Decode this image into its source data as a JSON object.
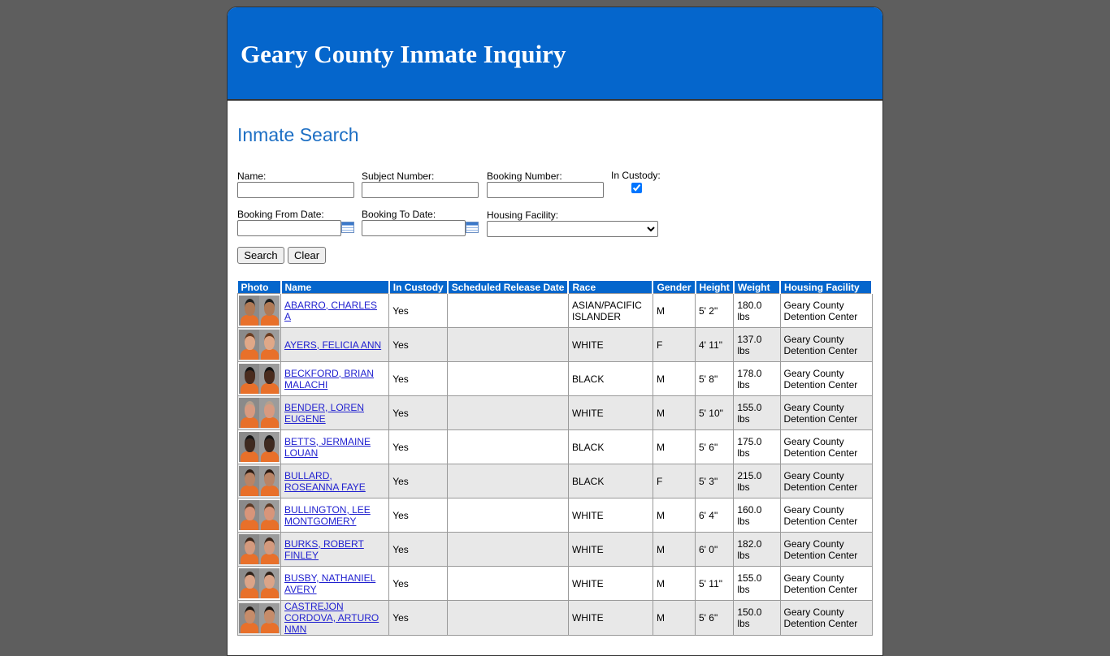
{
  "header": {
    "title": "Geary County Inmate Inquiry"
  },
  "search": {
    "heading": "Inmate Search",
    "name_label": "Name:",
    "name_value": "",
    "subject_label": "Subject Number:",
    "subject_value": "",
    "booking_label": "Booking Number:",
    "booking_value": "",
    "custody_label": "In Custody:",
    "custody_checked": true,
    "from_label": "Booking From Date:",
    "from_value": "",
    "to_label": "Booking To Date:",
    "to_value": "",
    "facility_label": "Housing Facility:",
    "facility_value": "",
    "search_button": "Search",
    "clear_button": "Clear"
  },
  "table": {
    "headers": [
      "Photo",
      "Name",
      "In Custody",
      "Scheduled Release Date",
      "Race",
      "Gender",
      "Height",
      "Weight",
      "Housing Facility"
    ],
    "rows": [
      {
        "name": "ABARRO, CHARLES A",
        "custody": "Yes",
        "release": "",
        "race": "ASIAN/PACIFIC ISLANDER",
        "gender": "M",
        "height": "5' 2\"",
        "weight": "180.0 lbs",
        "facility": "Geary County Detention Center",
        "skin": "#b07a56",
        "hair": "#1d1d1d"
      },
      {
        "name": "AYERS, FELICIA ANN",
        "custody": "Yes",
        "release": "",
        "race": "WHITE",
        "gender": "F",
        "height": "4' 11\"",
        "weight": "137.0 lbs",
        "facility": "Geary County Detention Center",
        "skin": "#e0a888",
        "hair": "#6b3e22"
      },
      {
        "name": "BECKFORD, BRIAN MALACHI",
        "custody": "Yes",
        "release": "",
        "race": "BLACK",
        "gender": "M",
        "height": "5' 8\"",
        "weight": "178.0 lbs",
        "facility": "Geary County Detention Center",
        "skin": "#4a2c1e",
        "hair": "#111111"
      },
      {
        "name": "BENDER, LOREN EUGENE",
        "custody": "Yes",
        "release": "",
        "race": "WHITE",
        "gender": "M",
        "height": "5' 10\"",
        "weight": "155.0 lbs",
        "facility": "Geary County Detention Center",
        "skin": "#d89a80",
        "hair": "#b7a08c"
      },
      {
        "name": "BETTS, JERMAINE LOUAN",
        "custody": "Yes",
        "release": "",
        "race": "BLACK",
        "gender": "M",
        "height": "5' 6\"",
        "weight": "175.0 lbs",
        "facility": "Geary County Detention Center",
        "skin": "#3f2a20",
        "hair": "#151515"
      },
      {
        "name": "BULLARD, ROSEANNA FAYE",
        "custody": "Yes",
        "release": "",
        "race": "BLACK",
        "gender": "F",
        "height": "5' 3\"",
        "weight": "215.0 lbs",
        "facility": "Geary County Detention Center",
        "skin": "#b98466",
        "hair": "#2b1a12"
      },
      {
        "name": "BULLINGTON, LEE MONTGOMERY",
        "custody": "Yes",
        "release": "",
        "race": "WHITE",
        "gender": "M",
        "height": "6' 4\"",
        "weight": "160.0 lbs",
        "facility": "Geary County Detention Center",
        "skin": "#d8957a",
        "hair": "#5b3a26"
      },
      {
        "name": "BURKS, ROBERT FINLEY",
        "custody": "Yes",
        "release": "",
        "race": "WHITE",
        "gender": "M",
        "height": "6' 0\"",
        "weight": "182.0 lbs",
        "facility": "Geary County Detention Center",
        "skin": "#d49a7e",
        "hair": "#3a2418"
      },
      {
        "name": "BUSBY, NATHANIEL AVERY",
        "custody": "Yes",
        "release": "",
        "race": "WHITE",
        "gender": "M",
        "height": "5' 11\"",
        "weight": "155.0 lbs",
        "facility": "Geary County Detention Center",
        "skin": "#dba488",
        "hair": "#2e2018"
      },
      {
        "name": "CASTREJON CORDOVA, ARTURO NMN",
        "custody": "Yes",
        "release": "",
        "race": "WHITE",
        "gender": "M",
        "height": "5' 6\"",
        "weight": "150.0 lbs",
        "facility": "Geary County Detention Center",
        "skin": "#c68c6a",
        "hair": "#1a1410"
      }
    ]
  }
}
